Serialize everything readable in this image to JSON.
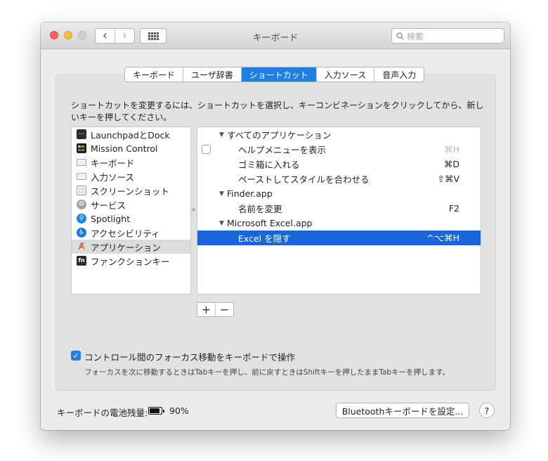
{
  "window": {
    "title": "キーボード",
    "search_placeholder": "検索",
    "nav_back": "‹",
    "nav_forward": "›"
  },
  "tabs": [
    {
      "label": "キーボード",
      "active": false
    },
    {
      "label": "ユーザ辞書",
      "active": false
    },
    {
      "label": "ショートカット",
      "active": true
    },
    {
      "label": "入力ソース",
      "active": false
    },
    {
      "label": "音声入力",
      "active": false
    }
  ],
  "description": "ショートカットを変更するには、ショートカットを選択し、キーコンビネーションをクリックしてから、新しいキーを押してください。",
  "categories": [
    {
      "label": "LaunchpadとDock",
      "icon": "launchpad-icon",
      "glyph": "⋯"
    },
    {
      "label": "Mission Control",
      "icon": "mission-control-icon",
      "glyph": ""
    },
    {
      "label": "キーボード",
      "icon": "keyboard-icon",
      "glyph": ""
    },
    {
      "label": "入力ソース",
      "icon": "input-sources-icon",
      "glyph": ""
    },
    {
      "label": "スクリーンショット",
      "icon": "screenshot-icon",
      "glyph": "⬚"
    },
    {
      "label": "サービス",
      "icon": "services-gear-icon",
      "glyph": "⚙"
    },
    {
      "label": "Spotlight",
      "icon": "spotlight-icon",
      "glyph": "⚲"
    },
    {
      "label": "アクセシビリティ",
      "icon": "accessibility-icon",
      "glyph": "♿"
    },
    {
      "label": "アプリケーション",
      "icon": "app-shortcuts-icon",
      "glyph": "Ⱥ",
      "selected": true
    },
    {
      "label": "ファンクションキー",
      "icon": "fn-key-icon",
      "glyph": "fn"
    }
  ],
  "shortcuts": {
    "all_apps": "すべてのアプリケーション",
    "help_menu": {
      "label": "ヘルプメニューを表示",
      "key": "⌘H",
      "checked": false
    },
    "trash": {
      "label": "ゴミ箱に入れる",
      "key": "⌘D"
    },
    "paste_style": {
      "label": "ペーストしてスタイルを合わせる",
      "key": "⇧⌘V"
    },
    "finder": "Finder.app",
    "rename": {
      "label": "名前を変更",
      "key": "F2"
    },
    "excel": "Microsoft Excel.app",
    "hide_excel": {
      "label": "Excel を隠す",
      "key": "^⌥⌘H"
    },
    "expand_glyph": "▼"
  },
  "buttons": {
    "add": "+",
    "remove": "−",
    "bluetooth": "Bluetoothキーボードを設定...",
    "help": "?"
  },
  "focus": {
    "checked": true,
    "check_glyph": "✓",
    "label": "コントロール間のフォーカス移動をキーボードで操作",
    "description": "フォーカスを次に移動するときはTabキーを押し、前に戻すときはShiftキーを押したままTabキーを押します。"
  },
  "battery": {
    "label": "キーボードの電池残量:",
    "value": "90%",
    "level": 0.9
  },
  "colors": {
    "accent": "#1f7fe5",
    "selection": "#1866d8"
  }
}
